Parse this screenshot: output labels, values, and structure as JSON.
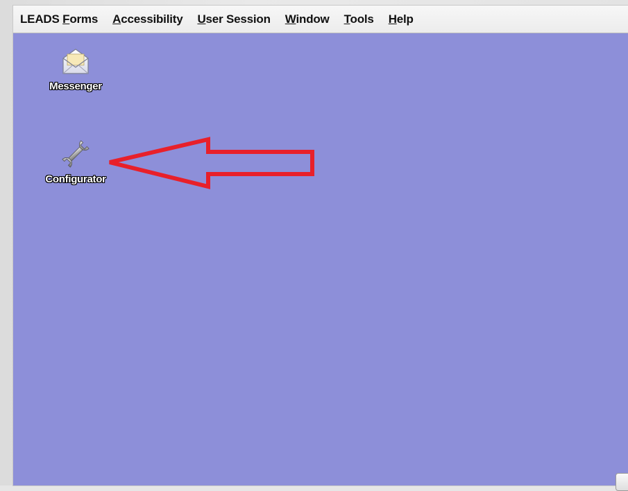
{
  "menubar": {
    "items": [
      {
        "label_pre": "LEADS ",
        "label_u": "F",
        "label_post": "orms"
      },
      {
        "label_pre": "",
        "label_u": "A",
        "label_post": "ccessibility"
      },
      {
        "label_pre": "",
        "label_u": "U",
        "label_post": "ser Session"
      },
      {
        "label_pre": "",
        "label_u": "W",
        "label_post": "indow"
      },
      {
        "label_pre": "",
        "label_u": "T",
        "label_post": "ools"
      },
      {
        "label_pre": "",
        "label_u": "H",
        "label_post": "elp"
      }
    ]
  },
  "desktop": {
    "background": "#8d8fd9",
    "icons": [
      {
        "label": "Messenger",
        "icon": "envelope-icon"
      },
      {
        "label": "Configurator",
        "icon": "wrench-icon"
      }
    ]
  },
  "annotation": {
    "arrow_color": "#e8202a",
    "arrow_direction": "left"
  }
}
